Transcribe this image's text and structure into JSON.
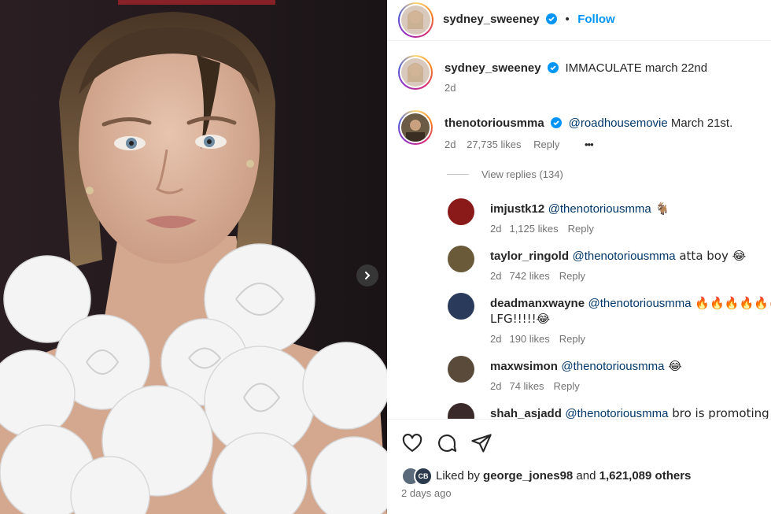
{
  "header": {
    "username": "sydney_sweeney",
    "separator": "•",
    "follow_label": "Follow"
  },
  "caption": {
    "username": "sydney_sweeney",
    "text": "IMMACULATE march 22nd",
    "time": "2d"
  },
  "top_comment": {
    "username": "thenotoriousmma",
    "mention": "@roadhousemovie",
    "text": " March 21st.",
    "time": "2d",
    "likes": "27,735 likes",
    "reply_label": "Reply",
    "more": "•••",
    "view_replies": "View replies (134)"
  },
  "replies": [
    {
      "username": "imjustk12",
      "mention": "@thenotoriousmma",
      "text": " 🐐",
      "time": "2d",
      "likes": "1,125 likes",
      "reply_label": "Reply",
      "avatar_color": "#8a1a1a"
    },
    {
      "username": "taylor_ringold",
      "mention": "@thenotoriousmma",
      "text": " atta boy 😂",
      "time": "2d",
      "likes": "742 likes",
      "reply_label": "Reply",
      "avatar_color": "#6b5a3a"
    },
    {
      "username": "deadmanxwayne",
      "mention": "@thenotoriousmma",
      "text": " 🔥🔥🔥🔥🔥🔥",
      "text2": "LFG!!!!!😂",
      "time": "2d",
      "likes": "190 likes",
      "reply_label": "Reply",
      "avatar_color": "#2a3a5a"
    },
    {
      "username": "maxwsimon",
      "mention": "@thenotoriousmma",
      "text": " 😂",
      "time": "2d",
      "likes": "74 likes",
      "reply_label": "Reply",
      "avatar_color": "#5a4a3a"
    },
    {
      "username": "shah_asjadd",
      "mention": "@thenotoriousmma",
      "text": " bro is promoting",
      "avatar_color": "#3a2a2a"
    }
  ],
  "footer": {
    "liked_by_prefix": "Liked by ",
    "liked_by_user": "george_jones98",
    "liked_by_and": " and ",
    "liked_by_count": "1,621,089 others",
    "badge_text": "CB",
    "posted": "2 days ago"
  },
  "icons": [
    "heart-icon",
    "comment-icon",
    "share-icon",
    "verified-icon",
    "chevron-right-icon"
  ],
  "colors": {
    "follow": "#0095f6",
    "verified": "#0095f6",
    "mention": "#00376b",
    "muted": "#737373"
  }
}
